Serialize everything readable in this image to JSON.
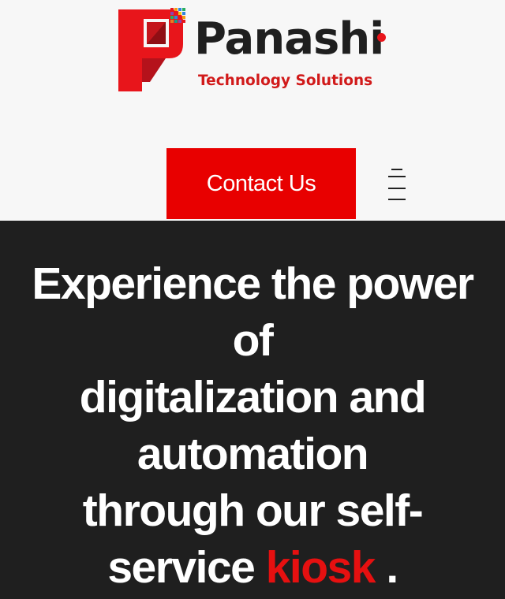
{
  "brand": {
    "name": "Panashi",
    "tagline": "Technology Solutions",
    "logo_icon": "panashi-p-logo-icon",
    "colors": {
      "primary_red": "#e80000",
      "dark_red": "#c4161c",
      "text_dark": "#1f1f1f"
    }
  },
  "nav": {
    "contact_label": "Contact Us",
    "menu_icon": "hamburger-menu-icon"
  },
  "hero": {
    "line1": "Experience the power",
    "line2": "of",
    "line3": "digitalization and",
    "line4": "automation",
    "line5_before": "through our self-",
    "line6_before": "service",
    "accent_word": "kiosk",
    "line6_after": ".",
    "accent_color": "#e61010",
    "background": "#1f1f1f"
  }
}
